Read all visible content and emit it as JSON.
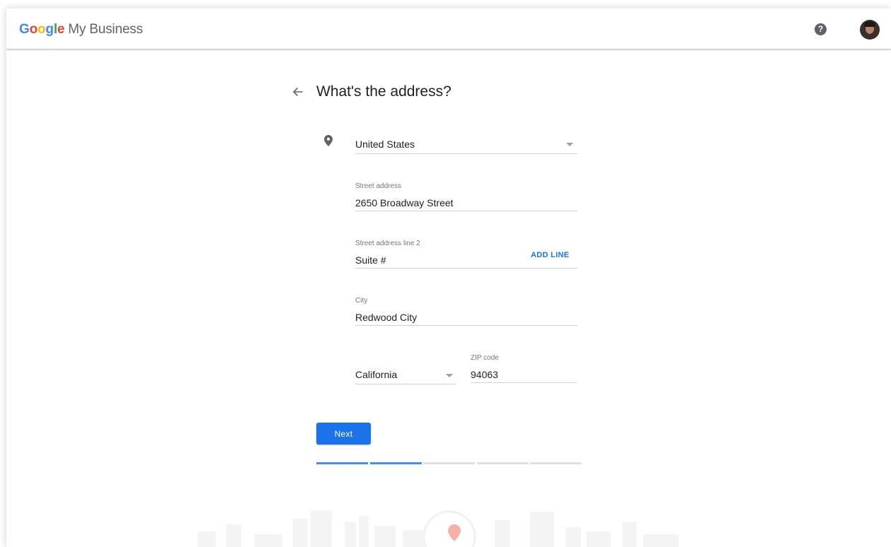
{
  "header": {
    "logo_letters": [
      "G",
      "o",
      "o",
      "g",
      "l",
      "e"
    ],
    "product_name": "My Business",
    "help_glyph": "?",
    "icons": [
      "help-icon",
      "avatar"
    ]
  },
  "page": {
    "title": "What's the address?",
    "back_icon": "arrow-back-icon",
    "location_icon": "map-pin-icon"
  },
  "form": {
    "country": {
      "value": "United States"
    },
    "street": {
      "label": "Street address",
      "value": "2650 Broadway Street"
    },
    "street2": {
      "label": "Street address line 2",
      "value": "Suite #",
      "action": "ADD LINE"
    },
    "city": {
      "label": "City",
      "value": "Redwood City"
    },
    "state": {
      "value": "California"
    },
    "zip": {
      "label": "ZIP code",
      "value": "94063"
    }
  },
  "actions": {
    "next_label": "Next"
  },
  "progress": {
    "steps_total": 5,
    "steps_done": 2
  },
  "colors": {
    "primary": "#1a73e8",
    "progress_done": "#4a8af4",
    "progress_todo": "#e0e0e0",
    "google_blue": "#4285f4",
    "google_red": "#ea4335",
    "google_yellow": "#fbbc05",
    "google_green": "#34a853"
  }
}
